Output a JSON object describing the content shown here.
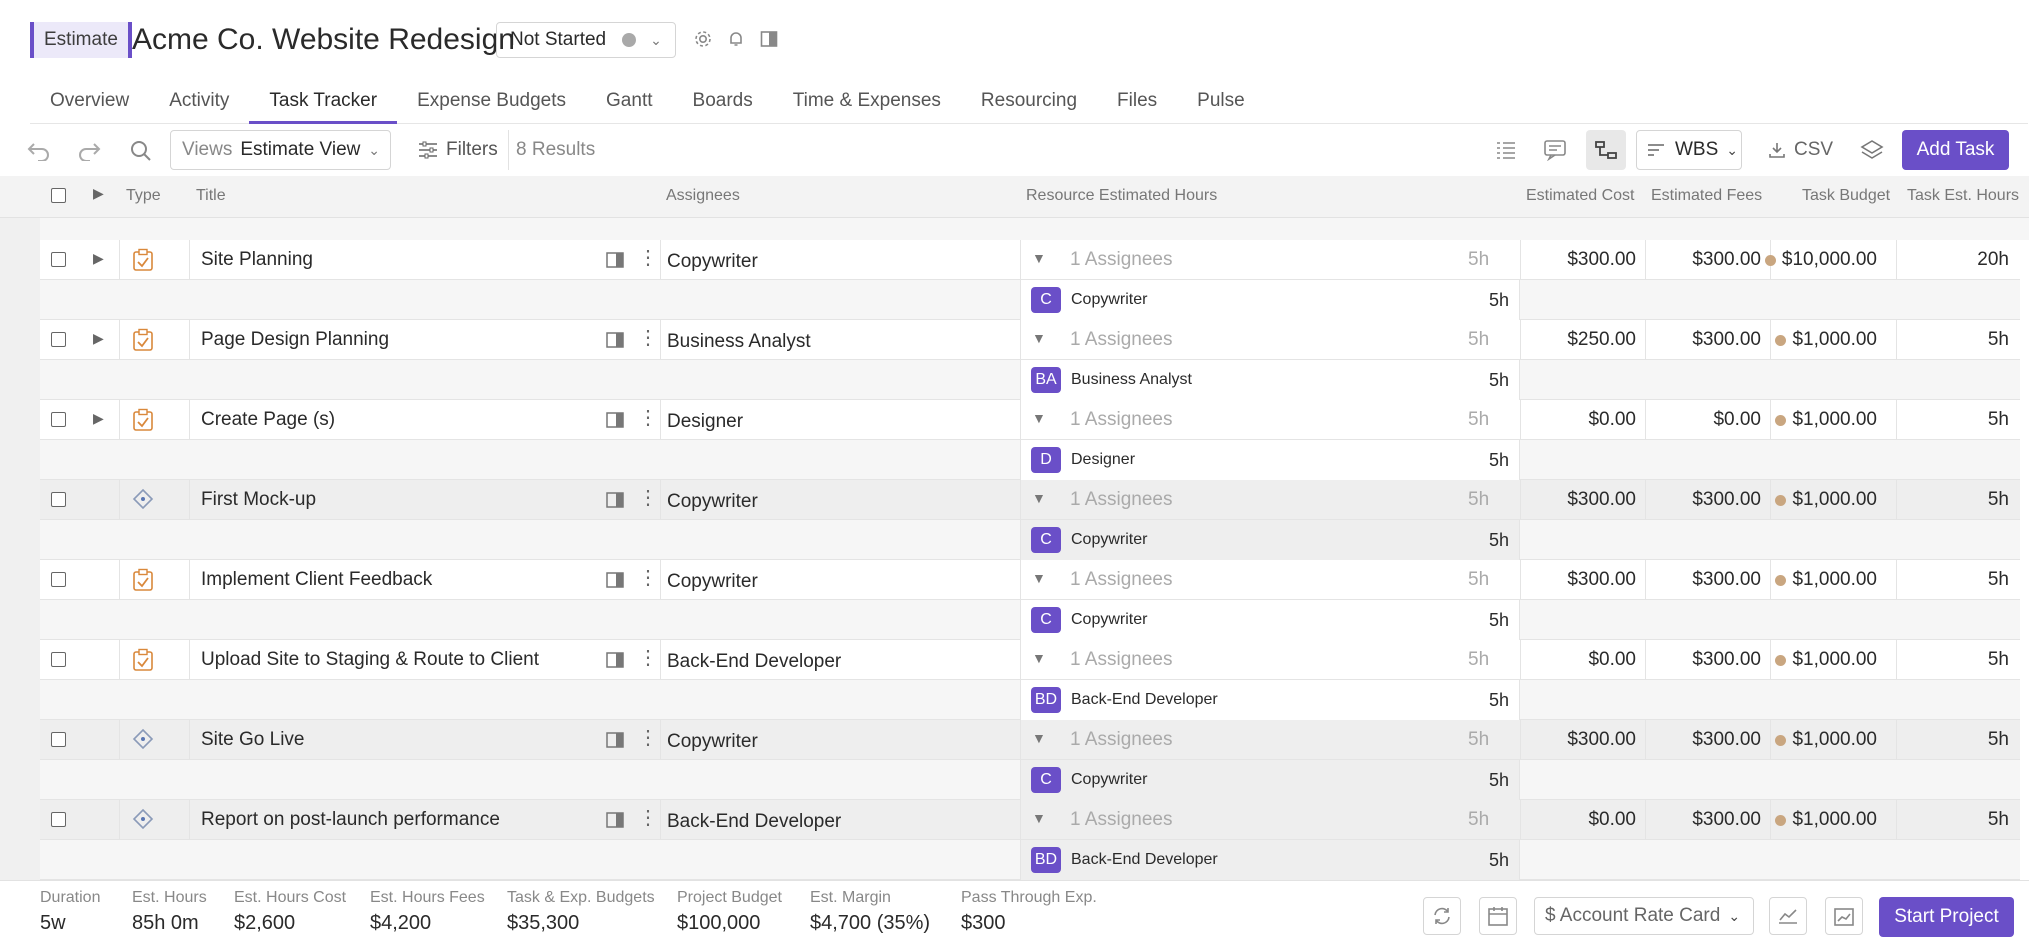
{
  "header": {
    "badge": "Estimate",
    "title": "Acme Co. Website Redesign",
    "status": "Not Started",
    "icons": [
      "gear-icon",
      "bell-icon",
      "side-panel-icon"
    ]
  },
  "tabs": [
    {
      "label": "Overview"
    },
    {
      "label": "Activity"
    },
    {
      "label": "Task Tracker",
      "active": true
    },
    {
      "label": "Expense Budgets"
    },
    {
      "label": "Gantt"
    },
    {
      "label": "Boards"
    },
    {
      "label": "Time & Expenses"
    },
    {
      "label": "Resourcing"
    },
    {
      "label": "Files"
    },
    {
      "label": "Pulse"
    }
  ],
  "toolbar": {
    "views_label": "Views",
    "views_value": "Estimate View",
    "filters": "Filters",
    "results": "8 Results",
    "sort": "WBS",
    "csv": "CSV",
    "add_task": "Add Task"
  },
  "columns": {
    "type": "Type",
    "title": "Title",
    "assignees": "Assignees",
    "resource_hours": "Resource Estimated Hours",
    "est_cost": "Estimated Cost",
    "est_fees": "Estimated Fees",
    "task_budget": "Task Budget",
    "task_est_hours": "Task Est. Hours"
  },
  "tasks": [
    {
      "type": "task",
      "expandable": true,
      "title": "Site Planning",
      "assignee": "Copywriter",
      "assignees_count": "1 Assignees",
      "res_hours": "5h",
      "cost": "$300.00",
      "fees": "$300.00",
      "budget": "$10,000.00",
      "est_hours": "20h",
      "sub": {
        "initials": "C",
        "name": "Copywriter",
        "hours": "5h"
      },
      "alt": false
    },
    {
      "type": "task",
      "expandable": true,
      "title": "Page Design Planning",
      "assignee": "Business Analyst",
      "assignees_count": "1 Assignees",
      "res_hours": "5h",
      "cost": "$250.00",
      "fees": "$300.00",
      "budget": "$1,000.00",
      "est_hours": "5h",
      "sub": {
        "initials": "BA",
        "name": "Business Analyst",
        "hours": "5h"
      },
      "alt": false
    },
    {
      "type": "task",
      "expandable": true,
      "title": "Create Page (s)",
      "assignee": "Designer",
      "assignees_count": "1 Assignees",
      "res_hours": "5h",
      "cost": "$0.00",
      "fees": "$0.00",
      "budget": "$1,000.00",
      "est_hours": "5h",
      "sub": {
        "initials": "D",
        "name": "Designer",
        "hours": "5h"
      },
      "alt": false
    },
    {
      "type": "milestone",
      "expandable": false,
      "title": "First Mock-up",
      "assignee": "Copywriter",
      "assignees_count": "1 Assignees",
      "res_hours": "5h",
      "cost": "$300.00",
      "fees": "$300.00",
      "budget": "$1,000.00",
      "est_hours": "5h",
      "sub": {
        "initials": "C",
        "name": "Copywriter",
        "hours": "5h"
      },
      "alt": true
    },
    {
      "type": "task",
      "expandable": false,
      "title": "Implement Client Feedback",
      "assignee": "Copywriter",
      "assignees_count": "1 Assignees",
      "res_hours": "5h",
      "cost": "$300.00",
      "fees": "$300.00",
      "budget": "$1,000.00",
      "est_hours": "5h",
      "sub": {
        "initials": "C",
        "name": "Copywriter",
        "hours": "5h"
      },
      "alt": false
    },
    {
      "type": "task",
      "expandable": false,
      "title": "Upload Site to Staging & Route to Client",
      "assignee": "Back-End Developer",
      "assignees_count": "1 Assignees",
      "res_hours": "5h",
      "cost": "$0.00",
      "fees": "$300.00",
      "budget": "$1,000.00",
      "est_hours": "5h",
      "sub": {
        "initials": "BD",
        "name": "Back-End Developer",
        "hours": "5h"
      },
      "alt": false
    },
    {
      "type": "milestone",
      "expandable": false,
      "title": "Site Go Live",
      "assignee": "Copywriter",
      "assignees_count": "1 Assignees",
      "res_hours": "5h",
      "cost": "$300.00",
      "fees": "$300.00",
      "budget": "$1,000.00",
      "est_hours": "5h",
      "sub": {
        "initials": "C",
        "name": "Copywriter",
        "hours": "5h"
      },
      "alt": true
    },
    {
      "type": "milestone",
      "expandable": false,
      "title": "Report on post-launch performance",
      "assignee": "Back-End Developer",
      "assignees_count": "1 Assignees",
      "res_hours": "5h",
      "cost": "$0.00",
      "fees": "$300.00",
      "budget": "$1,000.00",
      "est_hours": "5h",
      "sub": {
        "initials": "BD",
        "name": "Back-End Developer",
        "hours": "5h"
      },
      "alt": true
    }
  ],
  "footer": {
    "stats": [
      {
        "label": "Duration",
        "value": "5w"
      },
      {
        "label": "Est. Hours",
        "value": "85h 0m"
      },
      {
        "label": "Est. Hours Cost",
        "value": "$2,600"
      },
      {
        "label": "Est. Hours Fees",
        "value": "$4,200"
      },
      {
        "label": "Task & Exp. Budgets",
        "value": "$35,300"
      },
      {
        "label": "Project Budget",
        "value": "$100,000"
      },
      {
        "label": "Est. Margin",
        "value": "$4,700 (35%)"
      },
      {
        "label": "Pass Through Exp.",
        "value": "$300"
      }
    ],
    "rate_card": "$ Account Rate Card",
    "start_project": "Start Project"
  },
  "colors": {
    "accent": "#6a4fc8",
    "budget_dot": "#c9a680"
  }
}
